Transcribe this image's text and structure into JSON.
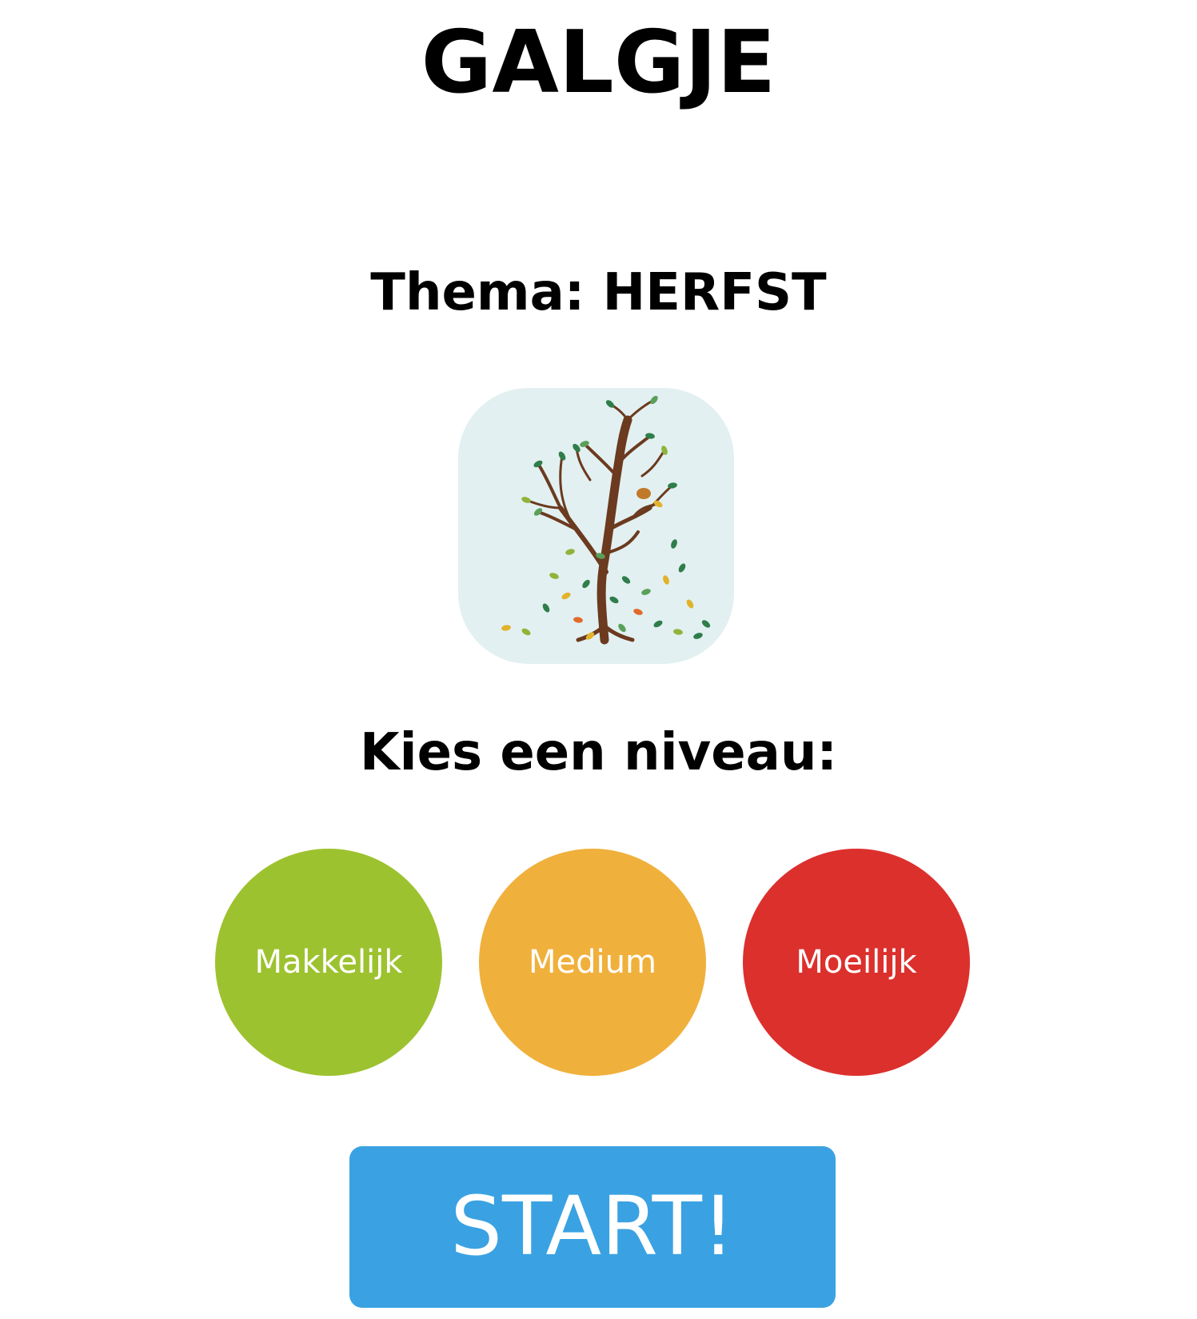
{
  "header": {
    "title": "GALGJE"
  },
  "theme": {
    "heading": "Thema: HERFST",
    "image_icon": "autumn-tree-illustration",
    "image_background": "#e2f0f1"
  },
  "levels": {
    "heading": "Kies een niveau:",
    "options": [
      {
        "label": "Makkelijk",
        "color": "#9dc22f"
      },
      {
        "label": "Medium",
        "color": "#f0b03c"
      },
      {
        "label": "Moeilijk",
        "color": "#dc302d"
      }
    ]
  },
  "start": {
    "label": "START!",
    "color": "#3aa2e2"
  }
}
